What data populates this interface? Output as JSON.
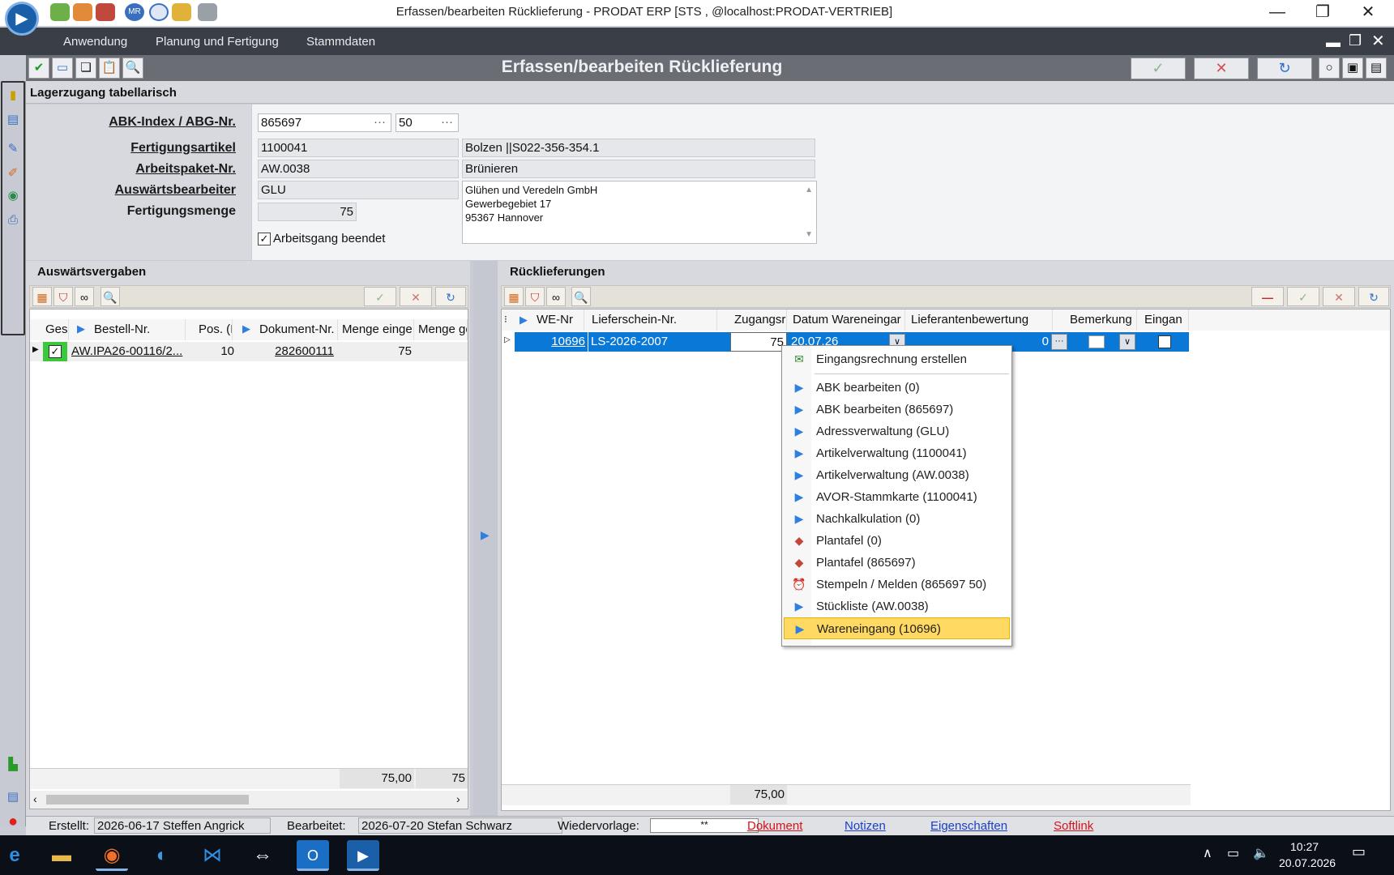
{
  "window": {
    "title": "Erfassen/bearbeiten Rücklieferung - PRODAT ERP   [STS , @localhost:PRODAT-VERTRIEB]",
    "minimize": "—",
    "restore": "❐",
    "close": "✕"
  },
  "menu": {
    "items": [
      "Anwendung",
      "Planung und Fertigung",
      "Stammdaten"
    ]
  },
  "header": {
    "title": "Erfassen/bearbeiten Rücklieferung",
    "confirm": "✓",
    "cancel": "✕",
    "refresh": "↻"
  },
  "form": {
    "section_title": "Lagerzugang tabellarisch",
    "labels": {
      "abk": "ABK-Index / ABG-Nr.",
      "article": "Fertigungsartikel",
      "workpackage": "Arbeitspaket-Nr.",
      "contractor": "Auswärtsbearbeiter",
      "quantity": "Fertigungsmenge"
    },
    "abk_index": "865697",
    "abg_nr": "50",
    "article_nr": "1100041",
    "article_desc": "Bolzen    ||S022-356-354.1",
    "workpackage_nr": "AW.0038",
    "workpackage_desc": "Brünieren",
    "contractor_code": "GLU",
    "address_lines": [
      "Glühen und Veredeln GmbH",
      "Gewerbegebiet 17",
      "95367 Hannover"
    ],
    "quantity": "75",
    "operation_finished_label": "Arbeitsgang beendet",
    "operation_finished": true
  },
  "left_pane": {
    "title": "Auswärtsvergaben",
    "columns": [
      "Ges",
      "Bestell-Nr.",
      "Pos. (I",
      "Dokument-Nr.",
      "Menge einge",
      "Menge ge"
    ],
    "rows": [
      {
        "checked": true,
        "order": "AW.IPA26-00116/2...",
        "pos": "10",
        "document": "282600111",
        "qty_in": "75",
        "qty_ge": ""
      }
    ],
    "footer": {
      "qty_in": "75,00",
      "qty_ge": "75"
    }
  },
  "right_pane": {
    "title": "Rücklieferungen",
    "columns": [
      "WE-Nr",
      "Lieferschein-Nr.",
      "Zugangsr",
      "Datum Wareneingar",
      "Lieferantenbewertung",
      "Bemerkung",
      "Eingan"
    ],
    "rows": [
      {
        "we_nr": "10696",
        "delivery_note": "LS-2026-2007",
        "qty": "75",
        "date": "20.07.26",
        "rating": "0",
        "remark": "",
        "eingang": false
      }
    ],
    "footer": {
      "qty": "75,00"
    }
  },
  "context_menu": {
    "items": [
      {
        "icon": "invoice-icon",
        "label": "Eingangsrechnung erstellen"
      },
      {
        "icon": "arrow-icon",
        "label": "ABK bearbeiten  (0)"
      },
      {
        "icon": "arrow-icon",
        "label": "ABK bearbeiten  (865697)"
      },
      {
        "icon": "arrow-icon",
        "label": "Adressverwaltung  (GLU)"
      },
      {
        "icon": "arrow-icon",
        "label": "Artikelverwaltung  (1100041)"
      },
      {
        "icon": "arrow-icon",
        "label": "Artikelverwaltung  (AW.0038)"
      },
      {
        "icon": "arrow-icon",
        "label": "AVOR-Stammkarte  (1100041)"
      },
      {
        "icon": "arrow-icon",
        "label": "Nachkalkulation  (0)"
      },
      {
        "icon": "plantafel-icon",
        "label": "Plantafel  (0)"
      },
      {
        "icon": "plantafel-icon",
        "label": "Plantafel  (865697)"
      },
      {
        "icon": "clock-icon",
        "label": "Stempeln / Melden  (865697 50)"
      },
      {
        "icon": "arrow-icon",
        "label": "Stückliste  (AW.0038)"
      },
      {
        "icon": "arrow-icon",
        "label": "Wareneingang  (10696)"
      }
    ],
    "selected_index": 12
  },
  "status": {
    "created_label": "Erstellt:",
    "created_value": "2026-06-17  Steffen Angrick",
    "edited_label": "Bearbeitet:",
    "edited_value": "2026-07-20  Stefan Schwarz",
    "resubmit_label": "Wiedervorlage:",
    "resubmit_value": "**",
    "links": [
      "Dokument",
      "Notizen",
      "Eigenschaften",
      "Softlink"
    ]
  },
  "taskbar": {
    "time": "10:27",
    "date": "20.07.2026"
  },
  "colors": {
    "selection_blue": "#0a78d7",
    "menu_highlight": "#ffd961",
    "red_link": "#d4141c",
    "blue_link": "#1a3fc4"
  }
}
